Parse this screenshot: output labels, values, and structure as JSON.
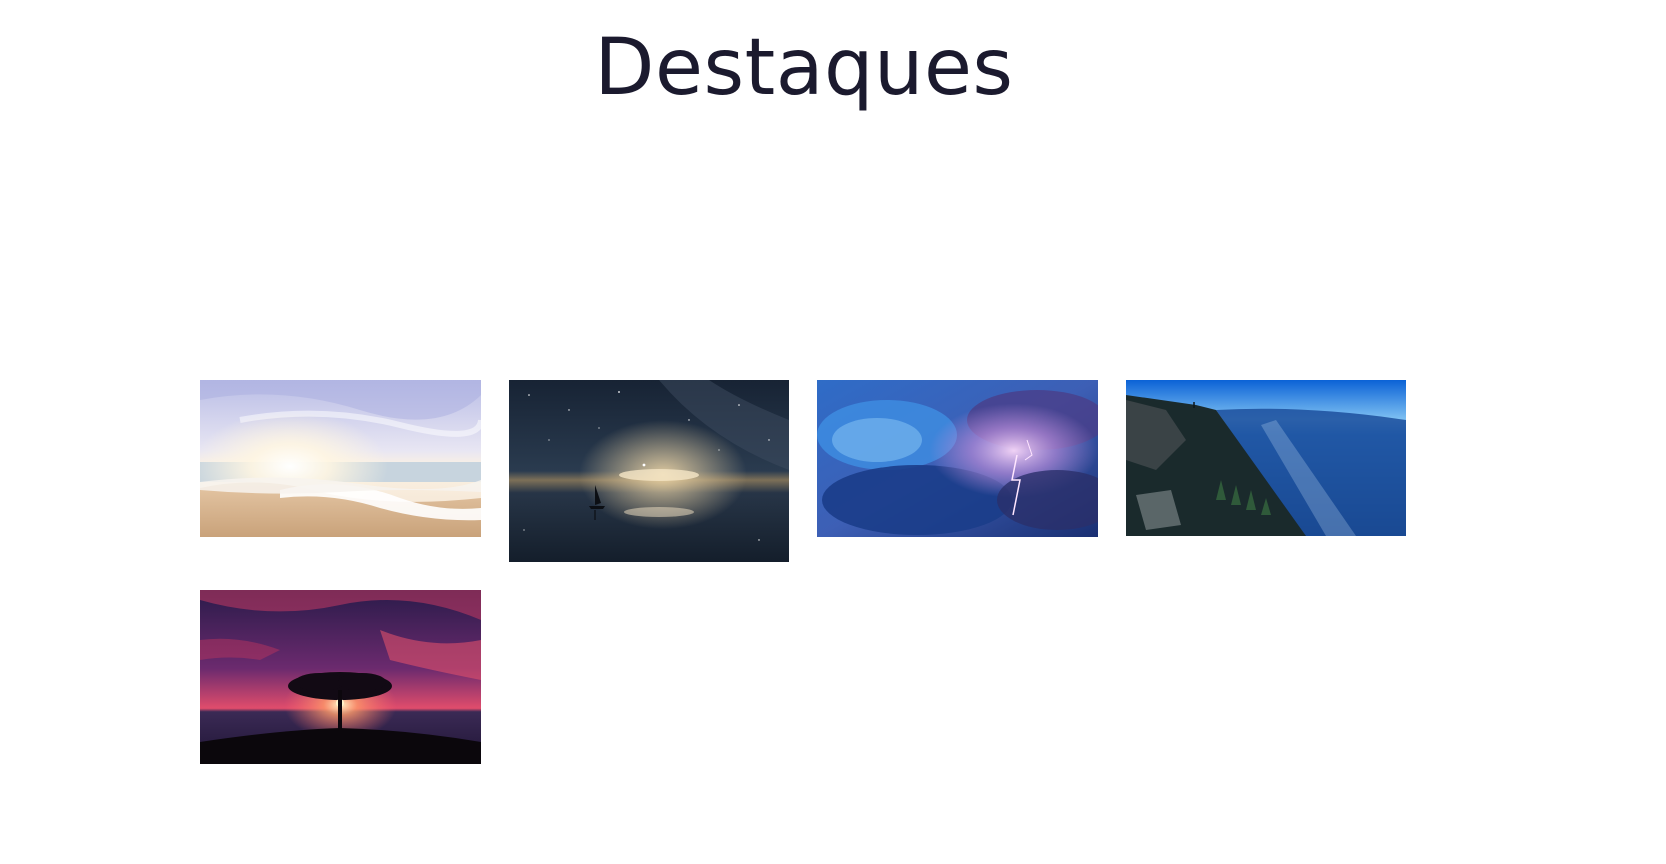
{
  "header": {
    "title": "Destaques"
  },
  "gallery": {
    "images": [
      {
        "subject": "beach-sunrise-waves",
        "colors": [
          "#c9cbe8",
          "#f4e9da",
          "#d8b58e"
        ]
      },
      {
        "subject": "night-sky-sailboat-reflection",
        "colors": [
          "#1a2638",
          "#2f4257",
          "#e3c79a"
        ]
      },
      {
        "subject": "storm-clouds-lightning",
        "colors": [
          "#1d4a9c",
          "#5aa0e0",
          "#b08ad0"
        ]
      },
      {
        "subject": "cliff-valley-blue-sky",
        "colors": [
          "#1e6fd6",
          "#0f2a55",
          "#263238"
        ]
      },
      {
        "subject": "tree-silhouette-red-sunset",
        "colors": [
          "#2c1a45",
          "#d4365a",
          "#160d1e"
        ]
      }
    ]
  }
}
